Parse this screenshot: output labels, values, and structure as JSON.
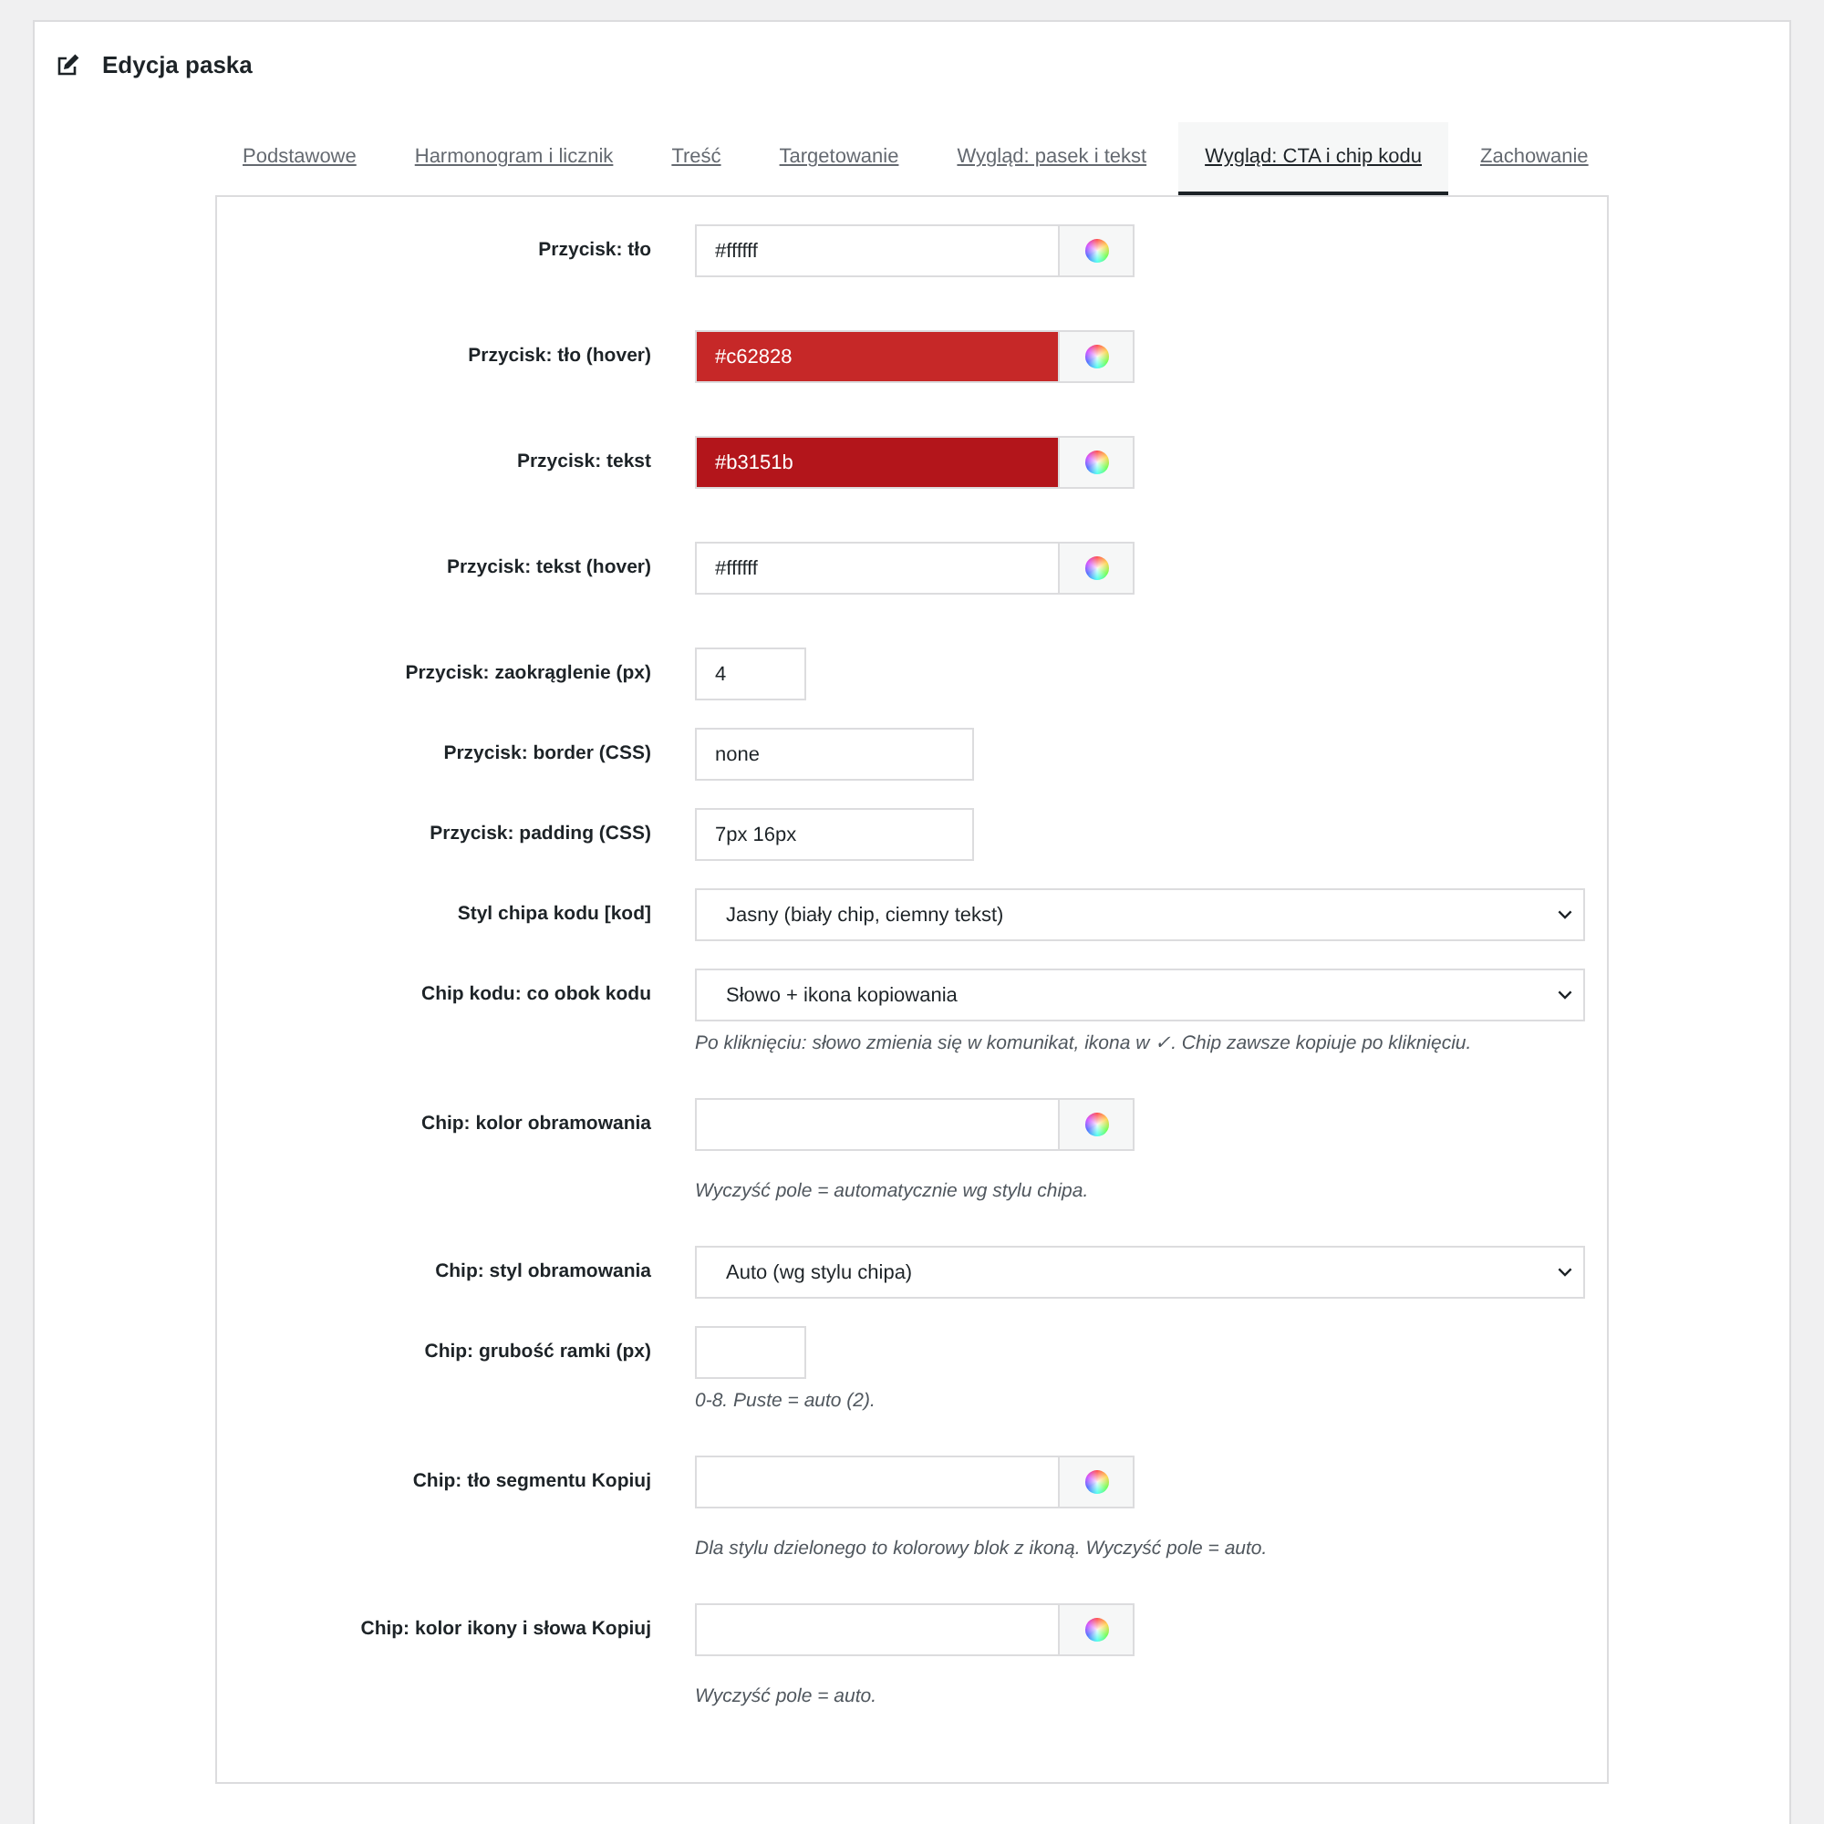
{
  "header": {
    "title": "Edycja paska"
  },
  "tabs": [
    {
      "label": "Podstawowe",
      "selected": false
    },
    {
      "label": "Harmonogram i licznik",
      "selected": false
    },
    {
      "label": "Treść",
      "selected": false
    },
    {
      "label": "Targetowanie",
      "selected": false
    },
    {
      "label": "Wygląd: pasek i tekst",
      "selected": false
    },
    {
      "label": "Wygląd: CTA i chip kodu",
      "selected": true
    },
    {
      "label": "Zachowanie",
      "selected": false
    }
  ],
  "fields": [
    {
      "kind": "color",
      "label": "Przycisk: tło",
      "value": "#ffffff",
      "color": "#ffffff"
    },
    {
      "kind": "color",
      "label": "Przycisk: tło (hover)",
      "value": "#c62828",
      "color": "#c62828"
    },
    {
      "kind": "color",
      "label": "Przycisk: tekst",
      "value": "#b3151b",
      "color": "#b3151b"
    },
    {
      "kind": "color",
      "label": "Przycisk: tekst (hover)",
      "value": "#ffffff",
      "color": "#ffffff"
    },
    {
      "kind": "number",
      "label": "Przycisk: zaokrąglenie (px)",
      "value": "4"
    },
    {
      "kind": "text",
      "label": "Przycisk: border (CSS)",
      "value": "none"
    },
    {
      "kind": "text",
      "label": "Przycisk: padding (CSS)",
      "value": "7px 16px"
    },
    {
      "kind": "select",
      "label": "Styl chipa kodu [kod]",
      "value": "Jasny (biały chip, ciemny tekst)"
    },
    {
      "kind": "select",
      "label": "Chip kodu: co obok kodu",
      "value": "Słowo + ikona kopiowania",
      "hint": "Po kliknięciu: słowo zmienia się w komunikat, ikona w ✓. Chip zawsze kopiuje po kliknięciu."
    },
    {
      "kind": "color",
      "label": "Chip: kolor obramowania",
      "hint": "Wyczyść pole = automatycznie wg stylu chipa."
    },
    {
      "kind": "select",
      "label": "Chip: styl obramowania",
      "value": "Auto (wg stylu chipa)"
    },
    {
      "kind": "number",
      "label": "Chip: grubość ramki (px)",
      "hint": "0-8. Puste = auto (2)."
    },
    {
      "kind": "color",
      "label": "Chip: tło segmentu Kopiuj",
      "hint": "Dla stylu dzielonego to kolorowy blok z ikoną. Wyczyść pole = auto."
    },
    {
      "kind": "color",
      "label": "Chip: kolor ikony i słowa Kopiuj",
      "hint": "Wyczyść pole = auto."
    }
  ]
}
